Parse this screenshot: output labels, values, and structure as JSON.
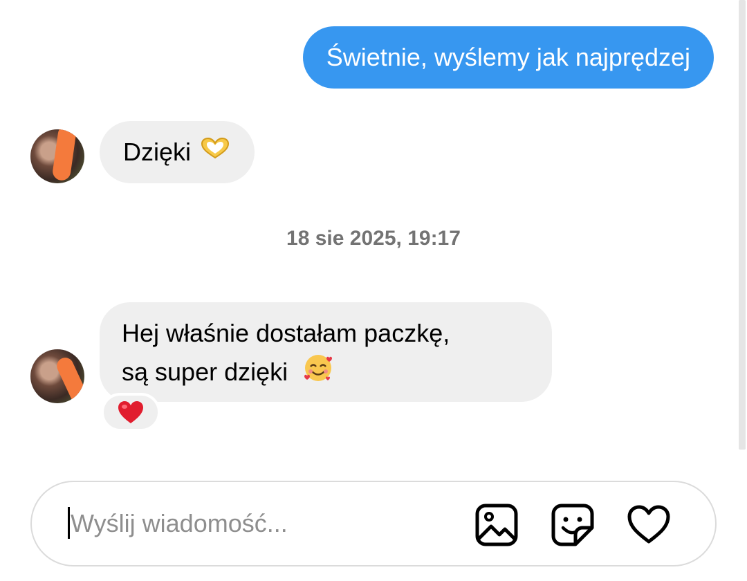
{
  "messages": {
    "outgoing_1": "Świetnie, wyślemy jak najprędzej",
    "incoming_1": "Dzięki",
    "incoming_1_emoji": "heart-hands-emoji",
    "timestamp": "18 sie 2025, 19:17",
    "incoming_2_line1": "Hej właśnie dostałam paczkę,",
    "incoming_2_line2": "są super dzięki",
    "incoming_2_emoji": "smiling-face-with-hearts-emoji",
    "reaction_emoji": "red-heart-emoji"
  },
  "composer": {
    "placeholder": "Wyślij wiadomość...",
    "value": "",
    "icons": [
      "image-icon",
      "sticker-icon",
      "heart-icon"
    ]
  },
  "colors": {
    "outgoing_bubble": "#3797f0",
    "incoming_bubble": "#efefef",
    "timestamp_text": "#737373",
    "placeholder_text": "#8e8e8e",
    "avatar_mark": "#f47a3c"
  }
}
